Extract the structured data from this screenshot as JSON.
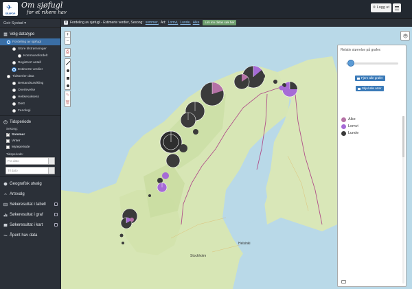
{
  "header": {
    "logo_text": "SEAPOP",
    "brand_line1": "Om sjøfugl",
    "brand_line2": "for et rikere hav",
    "login_label": "Logg ut"
  },
  "sidebar": {
    "user": "Geir Systad ▾",
    "section_data": "Velg datatype",
    "radios": [
      {
        "label": "Fordeling av sjøfugl",
        "selected": true
      },
      {
        "label": "Store tilstrømninger",
        "selected": false
      },
      {
        "label": "Kommunefordelt",
        "selected": false
      },
      {
        "label": "Registrert antall",
        "selected": false
      },
      {
        "label": "Estimerte verdier",
        "selected": true
      },
      {
        "label": "Tidsserier data",
        "selected": false
      },
      {
        "label": "Bestandsutvikling",
        "selected": false
      },
      {
        "label": "Overlevelse",
        "selected": false
      },
      {
        "label": "Hekkesuksess",
        "selected": false
      },
      {
        "label": "Diett",
        "selected": false
      },
      {
        "label": "Fenologi",
        "selected": false
      }
    ],
    "section_time": "Tidsperiode",
    "season_label": "Sesong:",
    "seasons": [
      {
        "label": "Sommer",
        "checked": true
      },
      {
        "label": "Vinter",
        "checked": false
      },
      {
        "label": "Myteperiode",
        "checked": false
      }
    ],
    "period_label": "Tidsperiode:",
    "from_placeholder": "Fra dato",
    "to_placeholder": "Til dato",
    "menu": [
      {
        "label": "Geografisk utvalg",
        "icon": "globe-icon"
      },
      {
        "label": "Artsvalg",
        "icon": "bird-icon"
      },
      {
        "label": "Søkeresultat i tabell",
        "icon": "table-icon"
      },
      {
        "label": "Søkeresultat i graf",
        "icon": "chart-icon"
      },
      {
        "label": "Søkeresultat i kart",
        "icon": "map-icon"
      },
      {
        "label": "Åpent hav data",
        "icon": "wave-icon"
      }
    ]
  },
  "map": {
    "filter_prefix": "Fordeling av sjøfugl - Estimerte verdier, Sesong:",
    "season_link": "sommer,",
    "species_prefix": "Art:",
    "species_links": [
      "Lomvi,",
      "Lunde,",
      "Alke"
    ],
    "badge": "Lim inn datas søk her",
    "zoom_in": "+",
    "zoom_out": "−",
    "cities": {
      "stockholm": "Stockholm",
      "helsinki": "Helsinki"
    }
  },
  "panel": {
    "title": "Relativ størrelse på grafer:",
    "remove_label": "Fjern alle grafer",
    "show_label": "Skjul alle arter",
    "legend": [
      {
        "label": "Alke",
        "color": "#b572a6"
      },
      {
        "label": "Lomvi",
        "color": "#a66bd6"
      },
      {
        "label": "Lunde",
        "color": "#3b3b3b"
      }
    ]
  },
  "colors": {
    "alke": "#b572a6",
    "lomvi": "#a66bd6",
    "lunde": "#3b3b3b",
    "sea": "#b9d9e8",
    "land": "#d7e6b5"
  }
}
